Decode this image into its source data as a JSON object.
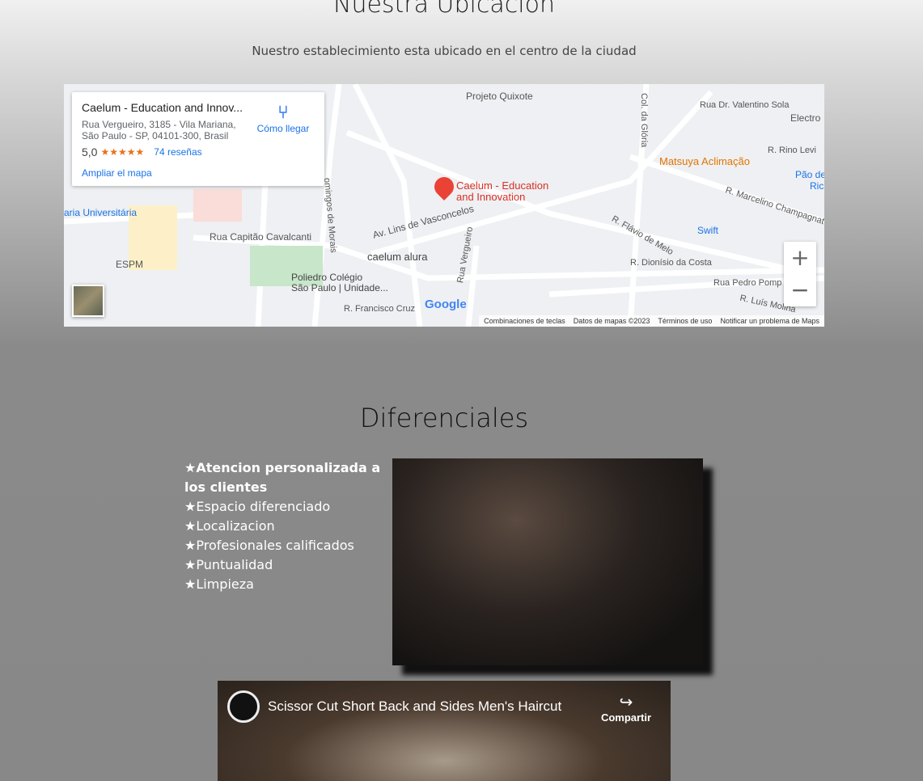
{
  "location": {
    "title": "Nuestra Ubicacion",
    "subtitle": "Nuestro establecimiento esta ubicado en el centro de la ciudad"
  },
  "map": {
    "card": {
      "name": "Caelum - Education and Innov...",
      "address1": "Rua Vergueiro, 3185 - Vila Mariana,",
      "address2": "São Paulo - SP, 04101-300, Brasil",
      "rating": "5,0",
      "stars": "★★★★★",
      "reviews": "74 reseñas",
      "directions": "Cómo llegar",
      "enlarge": "Ampliar el mapa"
    },
    "marker": {
      "line1": "Caelum - Education",
      "line2": "and Innovation"
    },
    "labels": [
      "Projeto Quixote",
      "Rua Dr. Valentino Sola",
      "Electro",
      "Matsuya Aclimação",
      "R. Rino Levi",
      "Pão de",
      "Ric",
      "R. Marcelino Champagnat",
      "aria Universitária",
      "Rua Capitão Cavalcanti",
      "ESPM",
      "Av. Lins de Vasconcelos",
      "caelum alura",
      "Poliedro Colégio",
      "São Paulo | Unidade...",
      "R. Flávio de Melo",
      "Swift",
      "R. Dionísio da Costa",
      "Rua Pedro Pomp",
      "R. Luís Molina",
      "R. Francisco Cruz",
      "Rua Vergueiro",
      "omingos de Morais",
      "Col. da Glória"
    ],
    "logo": "Google",
    "zoom_in": "+",
    "zoom_out": "−",
    "attribution": [
      "Combinaciones de teclas",
      "Datos de mapas ©2023",
      "Términos de uso",
      "Notificar un problema de Maps"
    ],
    "colors": {
      "marker": "#ea4335",
      "link": "#1a73e8",
      "poi_orange": "#e37400"
    }
  },
  "diferenciales": {
    "title": "Diferenciales",
    "items": [
      "★Atencion personalizada a los clientes",
      "★Espacio diferenciado",
      "★Localizacion",
      "★Profesionales calificados",
      "★Puntualidad",
      "★Limpieza"
    ]
  },
  "video": {
    "title": "Scissor Cut Short Back and Sides Men's Haircut",
    "share": "Compartir"
  }
}
